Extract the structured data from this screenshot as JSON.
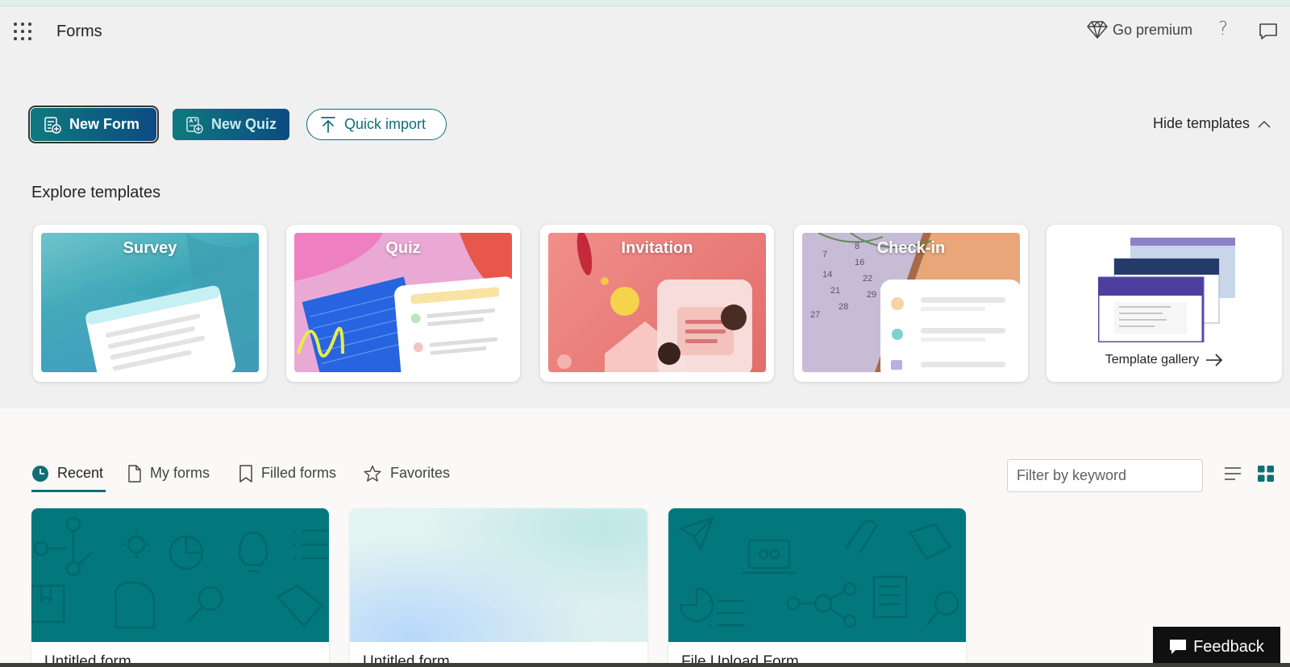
{
  "header": {
    "app_title": "Forms",
    "go_premium": "Go premium",
    "help": "?"
  },
  "actions": {
    "new_form": "New Form",
    "new_quiz": "New Quiz",
    "quick_import": "Quick import",
    "hide_templates": "Hide templates"
  },
  "templates": {
    "title": "Explore templates",
    "items": [
      {
        "label": "Survey"
      },
      {
        "label": "Quiz"
      },
      {
        "label": "Invitation"
      },
      {
        "label": "Check-in"
      }
    ],
    "gallery_label": "Template gallery"
  },
  "tabs": [
    {
      "label": "Recent",
      "active": true
    },
    {
      "label": "My forms"
    },
    {
      "label": "Filled forms"
    },
    {
      "label": "Favorites"
    }
  ],
  "filter": {
    "placeholder": "Filter by keyword"
  },
  "forms": [
    {
      "name": "Untitled form"
    },
    {
      "name": "Untitled form"
    },
    {
      "name": "File Upload Form"
    }
  ],
  "feedback": {
    "label": "Feedback"
  },
  "colors": {
    "accent": "#0f6f75",
    "banner_teal": "#03787c"
  }
}
